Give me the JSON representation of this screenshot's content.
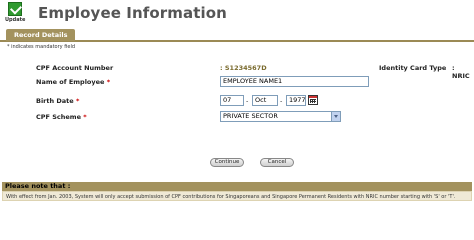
{
  "header": {
    "update_icon_label": "Update",
    "title": "Employee Information"
  },
  "tab": {
    "label": "Record Details"
  },
  "mandatory_note": "* indicates mandatory field",
  "fields": {
    "cpf_account": {
      "label": "CPF Account Number",
      "value": ": S1234567D"
    },
    "identity_card": {
      "label": "Identity Card Type",
      "value": ": NRIC"
    },
    "employee_name": {
      "label": "Name of Employee",
      "required_marker": "*",
      "value": "EMPLOYEE NAME1"
    },
    "birth_date": {
      "label": "Birth Date",
      "required_marker": "*",
      "day": "07",
      "month": "Oct",
      "year": "1977",
      "separator": "-"
    },
    "cpf_scheme": {
      "label": "CPF Scheme",
      "required_marker": "*",
      "selected": "PRIVATE SECTOR"
    }
  },
  "buttons": {
    "continue": "Continue",
    "cancel": "Cancel"
  },
  "notice": {
    "heading": "Please note that :",
    "text": "With effect from Jan. 2003, System will only accept submission of CPF contributions for Singaporeans and Singapore Permanent Residents with NRIC number starting with 'S' or 'T'."
  },
  "colors": {
    "accent": "#a3925e",
    "cpf_value": "#7a6b2e",
    "required": "#cc0000",
    "notice_bg": "#efe9d6"
  },
  "icons": {
    "update": "update-check-icon",
    "calendar": "calendar-icon",
    "dropdown": "chevron-down-icon"
  }
}
